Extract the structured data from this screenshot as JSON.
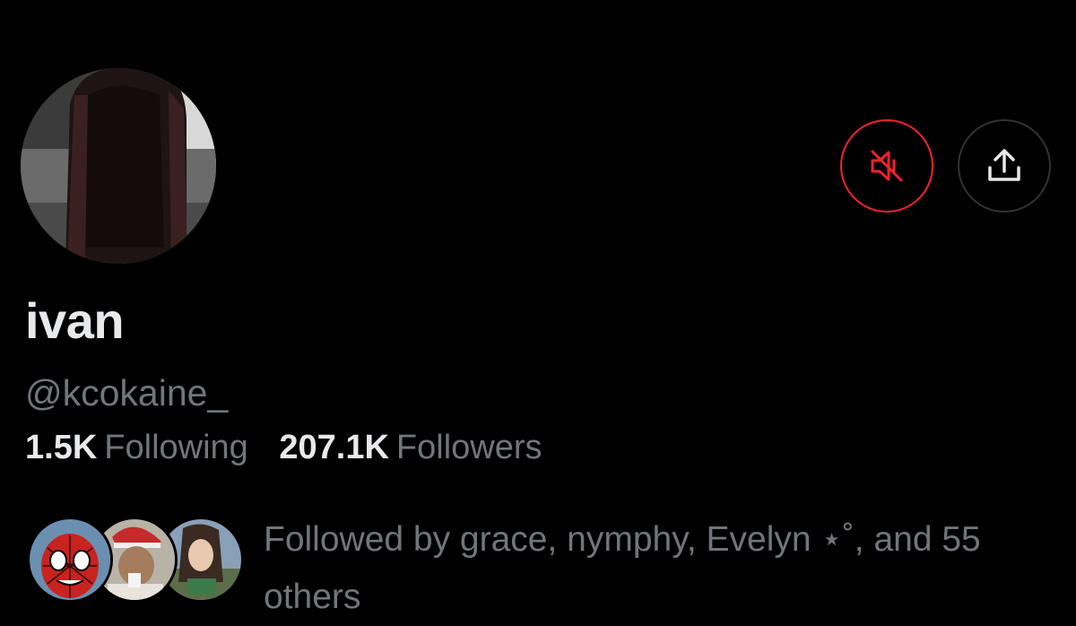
{
  "profile": {
    "display_name": "ivan",
    "handle": "@kcokaine_",
    "avatar_icon": "profile-photo",
    "following_count": "1.5K",
    "following_label": "Following",
    "followers_count": "207.1K",
    "followers_label": "Followers"
  },
  "actions": {
    "mute_icon": "speaker-muted-icon",
    "share_icon": "share-upload-icon",
    "mute_color": "#f4212e",
    "share_border_color": "#2f3336"
  },
  "followed_by": {
    "text": "Followed by grace, nymphy, Evelyn ⋆˚, and 55 others",
    "avatars": [
      "spiderman-avatar",
      "person-avatar",
      "anime-avatar"
    ]
  },
  "colors": {
    "background": "#000000",
    "primary_text": "#e7e9ea",
    "secondary_text": "#71767b"
  }
}
